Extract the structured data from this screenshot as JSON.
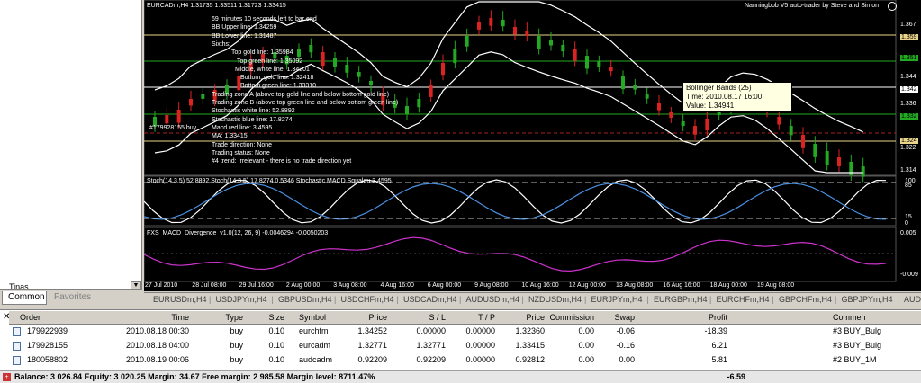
{
  "navigator": {
    "tree_label": "Tinas",
    "tabs": [
      "Common",
      "Favorites"
    ]
  },
  "chart": {
    "header": "EURCADm,H4  1.31735 1.33511 1.31723 1.33415",
    "ea_label": "Nanningbob V5 auto-trader by Steve and Simon",
    "face_icon": "smiley-face-icon",
    "info_lines": [
      "69 minutes 10 seconds left to bar end",
      "BB Upper line: 1.34259",
      "BB Lower line: 1.31487",
      "Sixths:",
      "Top gold line: 1.35984",
      "Top green line: 1.35092",
      "Middle, white line: 1.34201",
      "Bottom, gold line: 1.32418",
      "Bottom green line: 1.33310",
      "Trading zone A (above top gold line and below bottom gold line)",
      "Trading zone B (above top green line and below bottom green line)",
      "Stochastic white line: 52.8892",
      "Stochastic blue line: 17.8274",
      "Macd red line: 3.4595",
      "MA: 1.33415",
      "Trade direction: None",
      "Trading status: None",
      "#4 trend: Irrelevant - there is no trade direction yet"
    ],
    "order_label": "#179928155 buy",
    "tooltip": {
      "title": "Bollinger Bands (25)",
      "time": "Time: 2010.08.17 16:00",
      "value": "Value: 1.34941"
    },
    "price_axis": [
      "1.367",
      "1.359",
      "1.351",
      "1.344",
      "1.342",
      "1.336",
      "1.332",
      "1.324",
      "1.322",
      "1.314"
    ],
    "stoch_header": "Stoch(14,3,5) 52.8892 Stoch(14,3,5) 17.8274 0.5346  Stochastic MACD Squalou 3.4595",
    "stoch_axis": [
      "100",
      "85",
      "15",
      "0"
    ],
    "macd_header": "FXS_MACD_Divergence_v1.0(12, 26, 9) -0.0046294 -0.0050203",
    "macd_axis": [
      "0.005",
      "-0.009"
    ],
    "time_axis": [
      "27 Jul 2010",
      "28 Jul 08:00",
      "29 Jul 16:00",
      "2 Aug 00:00",
      "3 Aug 08:00",
      "4 Aug 16:00",
      "6 Aug 00:00",
      "9 Aug 08:00",
      "10 Aug 16:00",
      "12 Aug 00:00",
      "13 Aug 08:00",
      "16 Aug 16:00",
      "18 Aug 00:00",
      "19 Aug 08:00"
    ]
  },
  "symbol_tabs": [
    "EURUSDm,H4",
    "USDJPYm,H4",
    "GBPUSDm,H4",
    "USDCHFm,H4",
    "USDCADm,H4",
    "AUDUSDm,H4",
    "NZDUSDm,H4",
    "EURJPYm,H4",
    "EURGBPm,H4",
    "EURCHFm,H4",
    "GBPCHFm,H4",
    "GBPJPYm,H4",
    "AUD"
  ],
  "terminal": {
    "columns": [
      "Order",
      "Time",
      "Type",
      "Size",
      "Symbol",
      "Price",
      "S / L",
      "T / P",
      "Price",
      "Commission",
      "Swap",
      "Profit",
      "Commen"
    ],
    "rows": [
      [
        "179922939",
        "2010.08.18 00:30",
        "buy",
        "0.10",
        "eurchfm",
        "1.34252",
        "0.00000",
        "0.00000",
        "1.32360",
        "0.00",
        "-0.06",
        "-18.39",
        "#3 BUY_Bulg"
      ],
      [
        "179928155",
        "2010.08.18 04:00",
        "buy",
        "0.10",
        "eurcadm",
        "1.32771",
        "1.32771",
        "0.00000",
        "1.33415",
        "0.00",
        "-0.16",
        "6.21",
        "#3 BUY_Bulg"
      ],
      [
        "180058802",
        "2010.08.19 00:06",
        "buy",
        "0.10",
        "audcadm",
        "0.92209",
        "0.92209",
        "0.00000",
        "0.92812",
        "0.00",
        "0.00",
        "5.81",
        "#2 BUY_1M"
      ]
    ],
    "balance_line": "Balance: 3 026.84  Equity: 3 020.25  Margin: 34.67  Free margin: 2 985.58  Margin level: 8711.47%",
    "total_profit": "-6.59"
  },
  "colors": {
    "chart_bg": "#000000",
    "bull_candle": "#22aa22",
    "bear_candle": "#dd2222",
    "gold_line": "#e8d48a",
    "green_line": "#22aa22",
    "band_line": "#ffffff",
    "stoch_white": "#ffffff",
    "stoch_blue": "#4a90e2",
    "macd_magenta": "#cc33cc",
    "tooltip_bg": "#ffffe1"
  }
}
